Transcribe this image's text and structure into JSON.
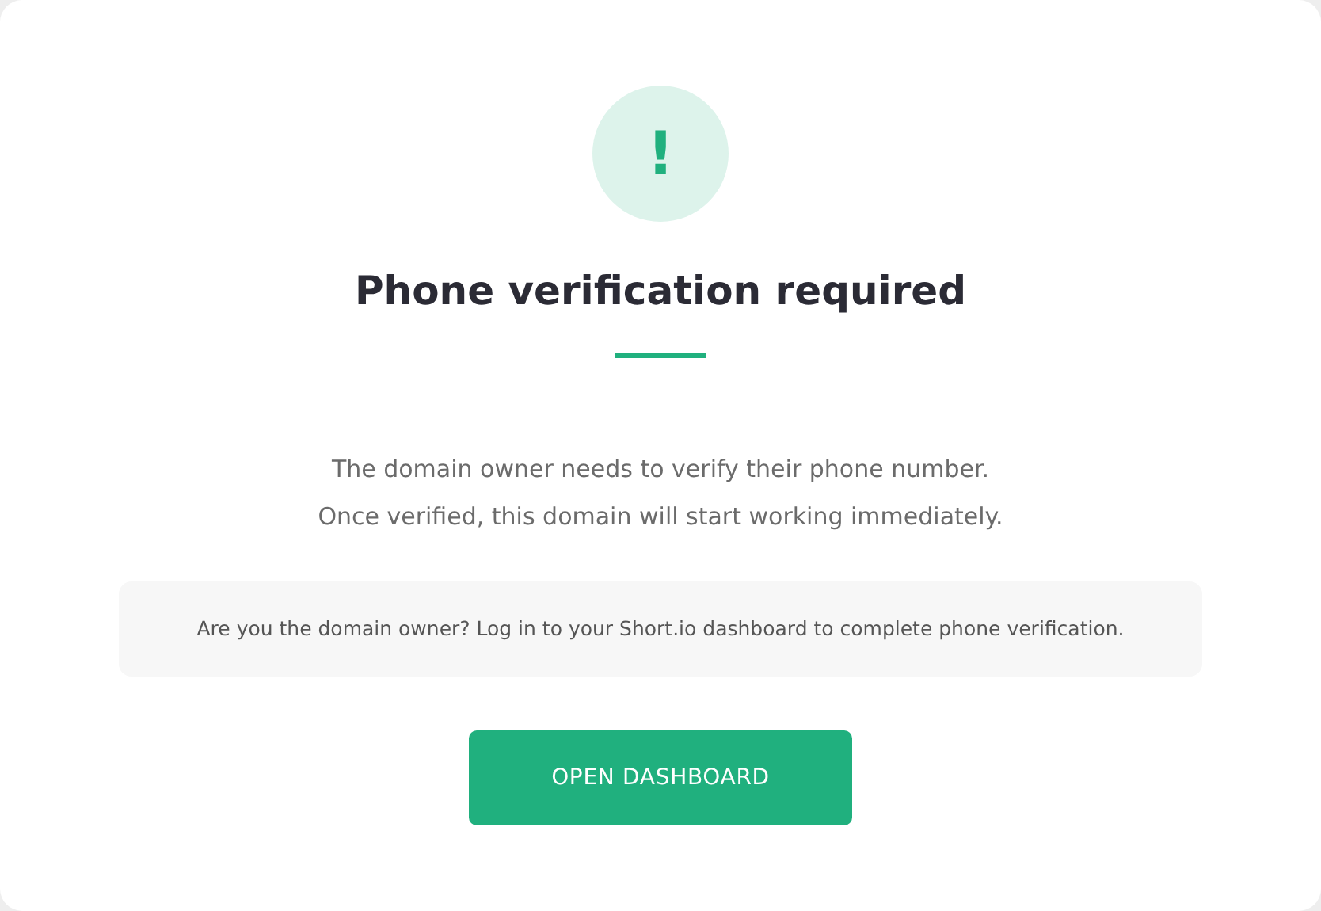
{
  "icon_symbol": "!",
  "title": "Phone verification required",
  "message_lines": [
    "The domain owner needs to verify their phone number.",
    "Once verified, this domain will start working immediately."
  ],
  "notice": "Are you the domain owner? Log in to your Short.io dashboard to complete phone verification.",
  "button": "OPEN DASHBOARD"
}
